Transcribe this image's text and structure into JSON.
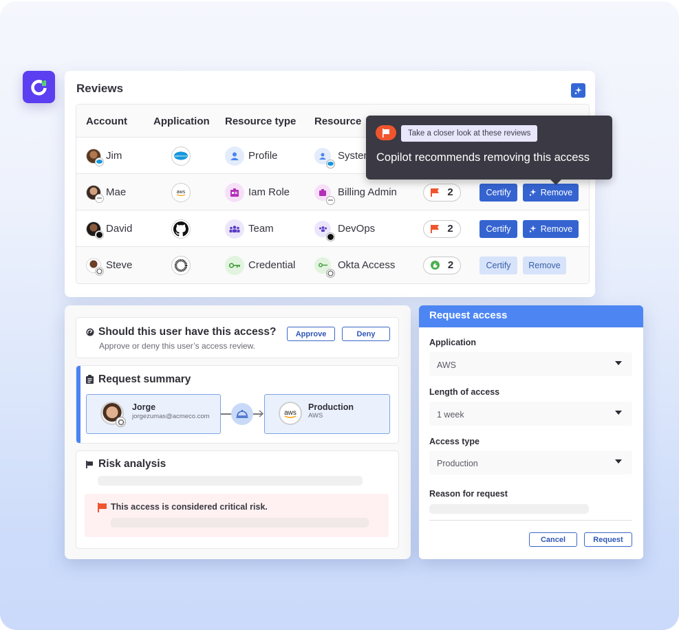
{
  "brand": {
    "accent": "#5b3ff0",
    "primary_blue": "#3564d1",
    "alert_orange": "#f0552e"
  },
  "reviews": {
    "title": "Reviews",
    "columns": [
      "Account",
      "Application",
      "Resource type",
      "Resource"
    ],
    "rows": [
      {
        "account": "Jim",
        "application": "salesforce",
        "resource_type": "Profile",
        "resource": "System",
        "risk_count": "",
        "risk_icon": "",
        "certify": "",
        "remove": ""
      },
      {
        "account": "Mae",
        "application": "aws",
        "resource_type": "Iam Role",
        "resource": "Billing Admin",
        "risk_count": "2",
        "risk_icon": "flag-icon",
        "certify": "Certify",
        "remove": "Remove"
      },
      {
        "account": "David",
        "application": "github",
        "resource_type": "Team",
        "resource": "DevOps",
        "risk_count": "2",
        "risk_icon": "flag-icon",
        "certify": "Certify",
        "remove": "Remove"
      },
      {
        "account": "Steve",
        "application": "okta",
        "resource_type": "Credential",
        "resource": "Okta Access",
        "risk_count": "2",
        "risk_icon": "thumbs-up-icon",
        "certify": "Certify",
        "remove": "Remove"
      }
    ]
  },
  "tooltip": {
    "chip": "Take a closer look at these reviews",
    "message": "Copilot recommends removing this access"
  },
  "review_panel": {
    "question": {
      "title": "Should this user have this access?",
      "subtitle": "Approve or deny this user’s access review.",
      "approve_label": "Approve",
      "deny_label": "Deny"
    },
    "summary": {
      "title": "Request summary",
      "user_name": "Jorge",
      "user_email": "jorgezumas@acmeco.com",
      "target_name": "Production",
      "target_app": "AWS"
    },
    "risk": {
      "title": "Risk analysis",
      "alert": "This access is considered critical risk."
    }
  },
  "request_access": {
    "title": "Request access",
    "fields": [
      {
        "label": "Application",
        "value": "AWS"
      },
      {
        "label": "Length of access",
        "value": "1 week"
      },
      {
        "label": "Access type",
        "value": "Production"
      }
    ],
    "reason_label": "Reason for request",
    "cancel_label": "Cancel",
    "request_label": "Request"
  }
}
